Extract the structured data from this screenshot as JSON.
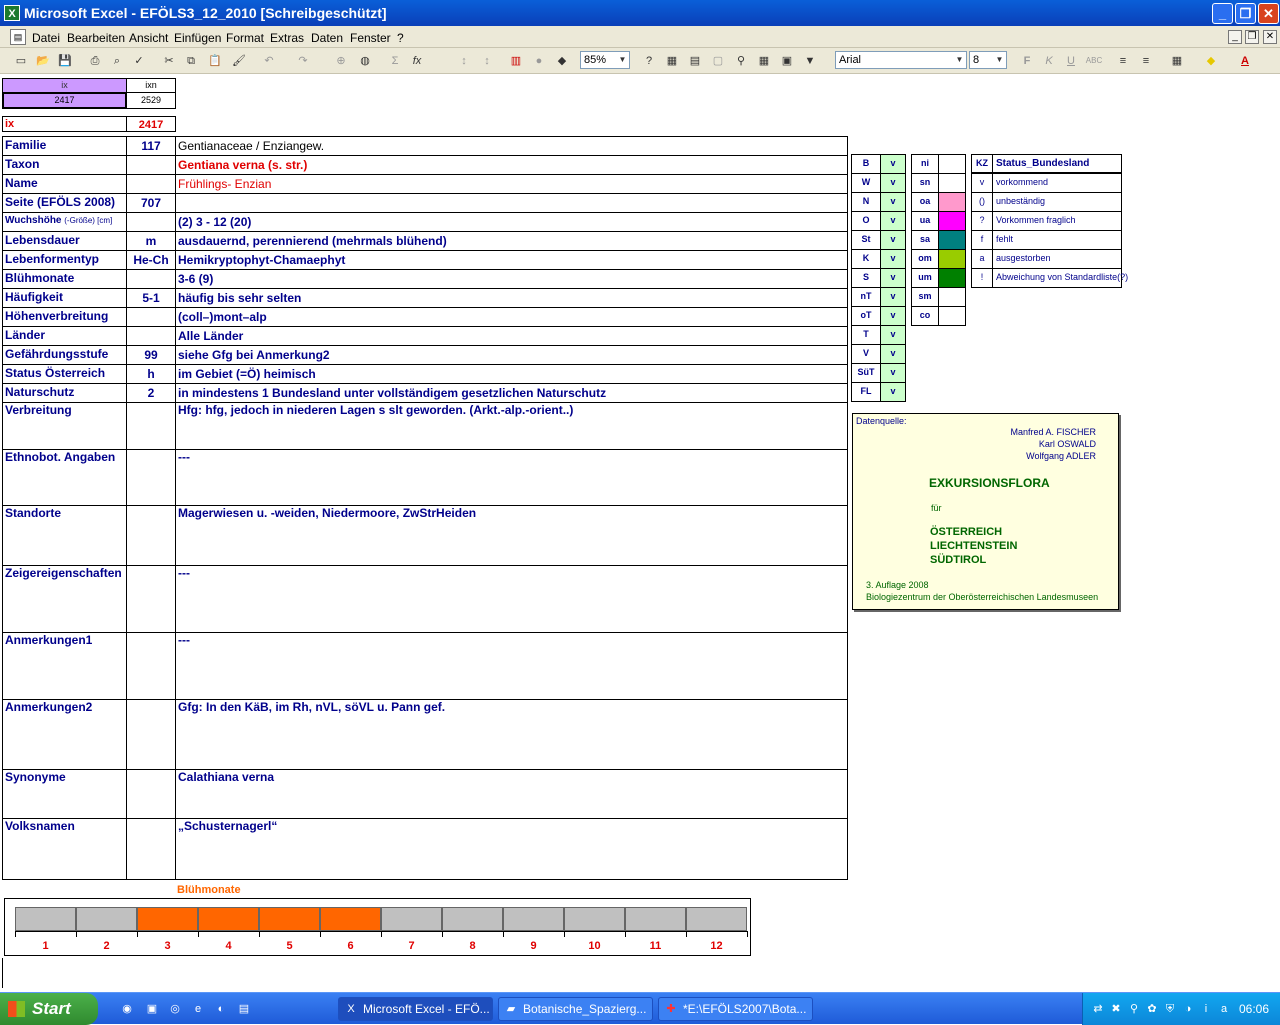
{
  "window": {
    "title": "Microsoft Excel - EFÖLS3_12_2010  [Schreibgeschützt]"
  },
  "menu": [
    "Datei",
    "Bearbeiten",
    "Ansicht",
    "Einfügen",
    "Format",
    "Extras",
    "Daten",
    "Fenster",
    "?"
  ],
  "toolbar": {
    "zoom": "85%",
    "font": "Arial",
    "size": "8"
  },
  "index": {
    "h1": "ix",
    "h2": "ixn",
    "v1": "2417",
    "v2": "2529",
    "ix_label": "ix",
    "ix_value": "2417"
  },
  "rows": [
    {
      "label": "Familie",
      "num": "117",
      "value": "Gentianaceae  /  Enziangew."
    },
    {
      "label": "Taxon",
      "num": "",
      "value": "Gentiana verna (s. str.)"
    },
    {
      "label": "Name",
      "num": "",
      "value": "Frühlings- Enzian"
    },
    {
      "label": "Seite (EFÖLS 2008)",
      "num": "707",
      "value": ""
    },
    {
      "label": "Wuchshöhe",
      "label_suffix": "(-Größe) [cm]",
      "num": "",
      "value": "(2) 3 - 12 (20)"
    },
    {
      "label": "Lebensdauer",
      "num": "m",
      "value": "ausdauernd, perennierend (mehrmals blühend)"
    },
    {
      "label": "Lebenformentyp",
      "num": "He-Ch",
      "value": "Hemikryptophyt-Chamaephyt"
    },
    {
      "label": "Blühmonate",
      "num": "",
      "value": "3-6 (9)"
    },
    {
      "label": "Häufigkeit",
      "num": "5-1",
      "value": "häufig bis sehr selten"
    },
    {
      "label": "Höhenverbreitung",
      "num": "",
      "value": "(coll–)mont–alp"
    },
    {
      "label": "Länder",
      "num": "",
      "value": "Alle Länder"
    },
    {
      "label": "Gefährdungsstufe",
      "num": "99",
      "value": "siehe Gfg bei Anmerkung2"
    },
    {
      "label": "Status Österreich",
      "num": "h",
      "value": "im Gebiet (=Ö) heimisch"
    },
    {
      "label": "Naturschutz",
      "num": "2",
      "value": "in mindestens 1 Bundesland unter vollständigem gesetzlichen Naturschutz"
    }
  ],
  "big_rows": [
    {
      "label": "Verbreitung",
      "value": "Hfg: hfg, jedoch in niederen Lagen s slt geworden.  (Arkt.-alp.-orient..)"
    },
    {
      "label": "Ethnobot. Angaben",
      "value": "---"
    },
    {
      "label": "Standorte",
      "value": "Magerwiesen u. -weiden, Niedermoore, ZwStrHeiden"
    },
    {
      "label": "Zeigereigenschaften",
      "value": "---"
    },
    {
      "label": "Anmerkungen1",
      "value": "---"
    },
    {
      "label": "Anmerkungen2",
      "value": "Gfg: In den KäB, im Rh, nVL, söVL u. Pann gef."
    },
    {
      "label": "Synonyme",
      "value": "Calathiana verna"
    },
    {
      "label": "Volksnamen",
      "value": "„Schusternagerl“"
    }
  ],
  "states": [
    {
      "code": "B",
      "v": "v"
    },
    {
      "code": "W",
      "v": "v"
    },
    {
      "code": "N",
      "v": "v"
    },
    {
      "code": "O",
      "v": "v"
    },
    {
      "code": "St",
      "v": "v"
    },
    {
      "code": "K",
      "v": "v"
    },
    {
      "code": "S",
      "v": "v"
    },
    {
      "code": "nT",
      "v": "v"
    },
    {
      "code": "oT",
      "v": "v"
    },
    {
      "code": "T",
      "v": "v"
    },
    {
      "code": "V",
      "v": "v"
    },
    {
      "code": "SüT",
      "v": "v"
    },
    {
      "code": "FL",
      "v": "v"
    }
  ],
  "region_codes": [
    {
      "code": "ni",
      "color": "#ffffff"
    },
    {
      "code": "sn",
      "color": "#ffffff"
    },
    {
      "code": "oa",
      "color": "#ff99cc"
    },
    {
      "code": "ua",
      "color": "#ff00ff"
    },
    {
      "code": "sa",
      "color": "#008080"
    },
    {
      "code": "om",
      "color": "#99cc00"
    },
    {
      "code": "um",
      "color": "#008000"
    },
    {
      "code": "sm",
      "color": "#ffffff"
    },
    {
      "code": "co",
      "color": "#ffffff"
    }
  ],
  "legend": {
    "h_kz": "KZ",
    "h_status": "Status_Bundesland",
    "items": [
      {
        "kz": "v",
        "text": "vorkommend"
      },
      {
        "kz": "()",
        "text": "unbeständig"
      },
      {
        "kz": "?",
        "text": "Vorkommen fraglich"
      },
      {
        "kz": "f",
        "text": "fehlt"
      },
      {
        "kz": "a",
        "text": "ausgestorben"
      },
      {
        "kz": "!",
        "text": "Abweichung von Standardliste(?)"
      }
    ]
  },
  "source": {
    "label": "Datenquelle:",
    "authors": [
      "Manfred A. FISCHER",
      "Karl OSWALD",
      "Wolfgang ADLER"
    ],
    "title": "EXKURSIONSFLORA",
    "fuer": "für",
    "countries": [
      "ÖSTERREICH",
      "LIECHTENSTEIN",
      "SÜDTIROL"
    ],
    "edition": "3. Auflage 2008",
    "publisher": "Biologiezentrum der Oberösterreichischen Landesmuseen"
  },
  "bluete": {
    "title": "Blühmonate",
    "months": [
      "1",
      "2",
      "3",
      "4",
      "5",
      "6",
      "7",
      "8",
      "9",
      "10",
      "11",
      "12"
    ],
    "active": [
      false,
      false,
      true,
      true,
      true,
      true,
      false,
      false,
      false,
      false,
      false,
      false
    ],
    "active_color": "#ff6600",
    "inactive_color": "#c0c0c0"
  },
  "taskbar": {
    "start": "Start",
    "tasks": [
      "Microsoft Excel - EFÖ...",
      "Botanische_Spazierg...",
      "*E:\\EFÖLS2007\\Bota..."
    ],
    "clock": "06:06"
  }
}
